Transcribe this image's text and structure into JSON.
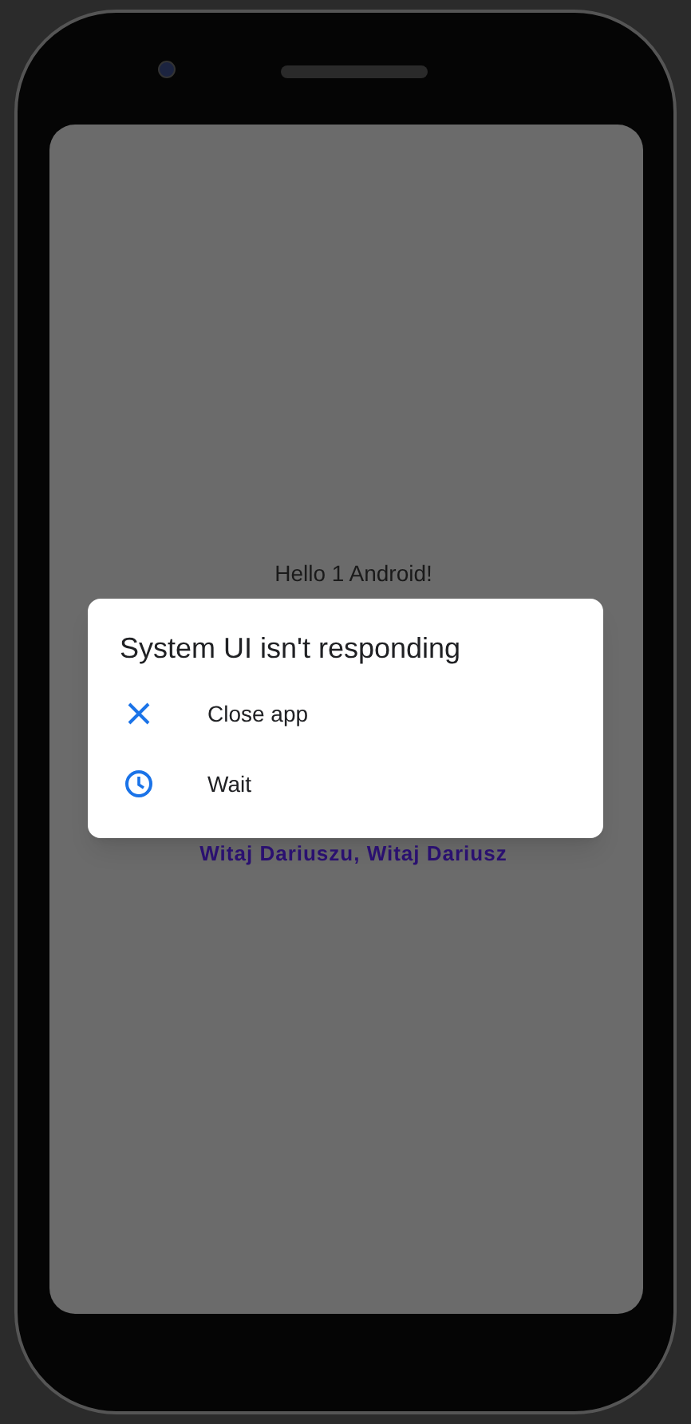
{
  "app": {
    "greeting": "Hello 1 Android!",
    "footer_text": "Witaj Dariuszu, Witaj Dariusz"
  },
  "dialog": {
    "title": "System UI isn't responding",
    "options": [
      {
        "kind": "close",
        "label": "Close app"
      },
      {
        "kind": "wait",
        "label": "Wait"
      }
    ]
  }
}
